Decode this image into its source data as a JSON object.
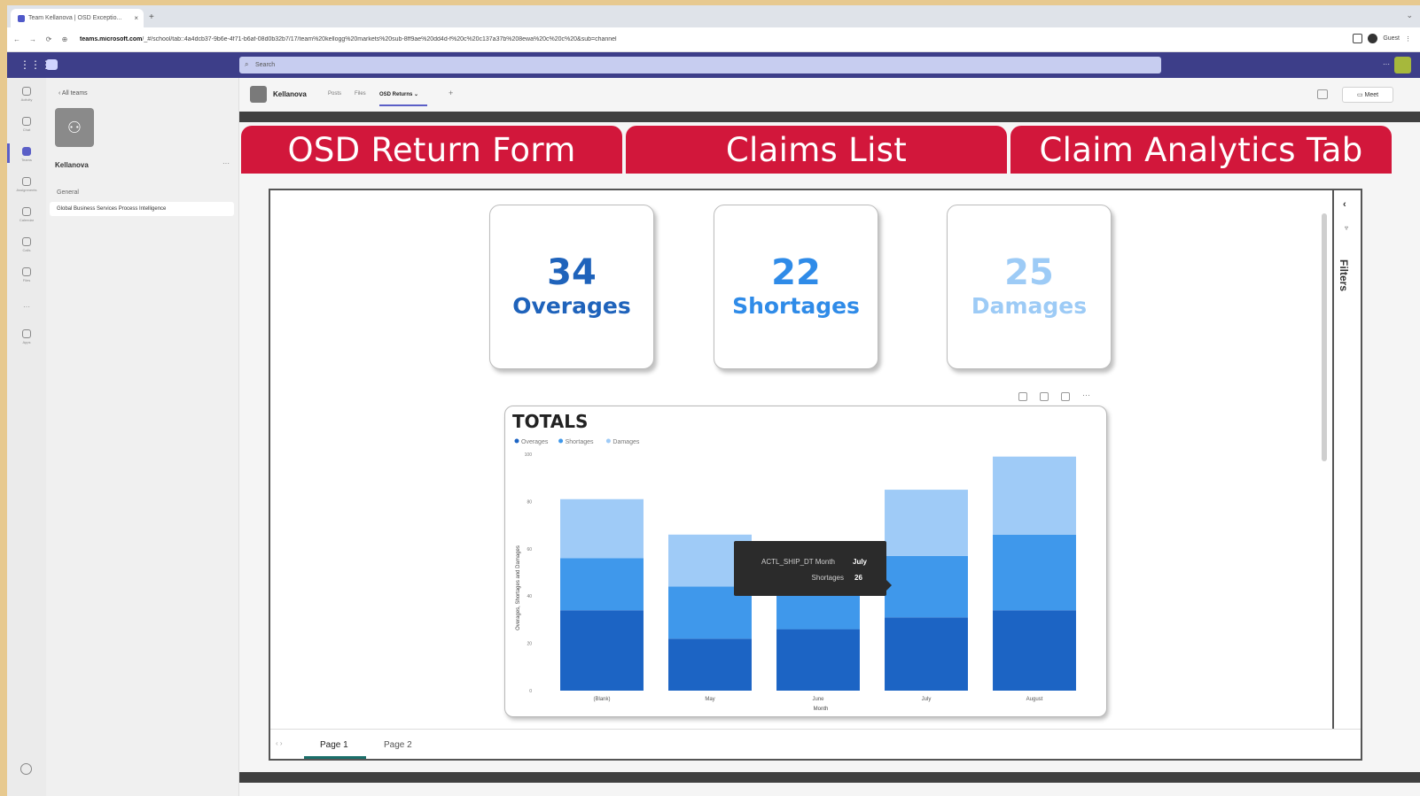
{
  "browser": {
    "tab_title": "Team Kellanova | OSD Exceptio...",
    "tab_close": "×",
    "new_tab": "+",
    "minimize": "⌄",
    "nav_back": "←",
    "nav_forward": "→",
    "nav_reload": "⟳",
    "nav_lock": "⊕",
    "url_host": "teams.microsoft.com",
    "url_path": "/_#/school/tab::4a4dcb37-9b6e-4f71-b6af-08d0b32b7/17/team%20kellogg%20markets%20sub-8ff9ae%20dd4d-f%20c%20c137a37b%208ewa%20c%20c%20&sub=channel",
    "profile_label": "Guest",
    "menu": "⋮"
  },
  "teams": {
    "search_placeholder": "Search",
    "header_more": "···",
    "rail": [
      {
        "label": "Activity"
      },
      {
        "label": "Chat"
      },
      {
        "label": "Teams"
      },
      {
        "label": "Assignments"
      },
      {
        "label": "Calendar"
      },
      {
        "label": "Calls"
      },
      {
        "label": "Files"
      },
      {
        "label": "···"
      },
      {
        "label": "Apps"
      }
    ],
    "rail_help": "Help",
    "back_label": "‹  All teams",
    "team_name": "Kellanova",
    "team_more": "···",
    "channel_general": "General",
    "channel_selected": "Global Business Services Process Intelligence"
  },
  "channel_header": {
    "name": "Kellanova",
    "tabs": [
      {
        "label": "Posts"
      },
      {
        "label": "Files"
      },
      {
        "label": "OSD Returns ⌄"
      }
    ],
    "add_tab": "+",
    "meet_label": "Meet"
  },
  "red_tabs": [
    {
      "label": "OSD Return Form"
    },
    {
      "label": "Claims List"
    },
    {
      "label": "Claim Analytics Tab"
    }
  ],
  "colors": {
    "red_tab": "#d2173b",
    "kpi_overages": "#1f63bb",
    "kpi_shortages": "#2f8be8",
    "kpi_damages": "#9dcbf6",
    "teams_purple": "#3d3e89"
  },
  "kpis": [
    {
      "value": "34",
      "label": "Overages",
      "color": "#1f63bb"
    },
    {
      "value": "22",
      "label": "Shortages",
      "color": "#2f8be8"
    },
    {
      "value": "25",
      "label": "Damages",
      "color": "#9dcbf6"
    }
  ],
  "filters": {
    "collapse": "‹",
    "funnel": "▿",
    "label": "Filters"
  },
  "pages": {
    "nav": "‹ ›",
    "items": [
      {
        "label": "Page 1"
      },
      {
        "label": "Page 2"
      }
    ]
  },
  "visual_header": {
    "more": "···"
  },
  "tooltip": {
    "row1_key": "ACTL_SHIP_DT Month",
    "row1_val": "July",
    "row2_key": "Shortages",
    "row2_val": "26"
  },
  "chart_data": {
    "type": "bar",
    "stacked": true,
    "title": "TOTALS",
    "xlabel": "Month",
    "ylabel": "Overages, Shortages and Damages",
    "categories": [
      "(Blank)",
      "May",
      "June",
      "July",
      "August"
    ],
    "series": [
      {
        "name": "Overages",
        "color": "#1c64c4",
        "values": [
          34,
          22,
          26,
          31,
          34
        ]
      },
      {
        "name": "Shortages",
        "color": "#3f98eb",
        "values": [
          22,
          22,
          24,
          26,
          32
        ]
      },
      {
        "name": "Damages",
        "color": "#9fcbf7",
        "values": [
          25,
          22,
          9,
          28,
          33
        ]
      }
    ],
    "ylim": [
      0,
      100
    ],
    "yticks": [
      0,
      20,
      40,
      60,
      80,
      100
    ],
    "legend": "top-left",
    "grid": false
  }
}
